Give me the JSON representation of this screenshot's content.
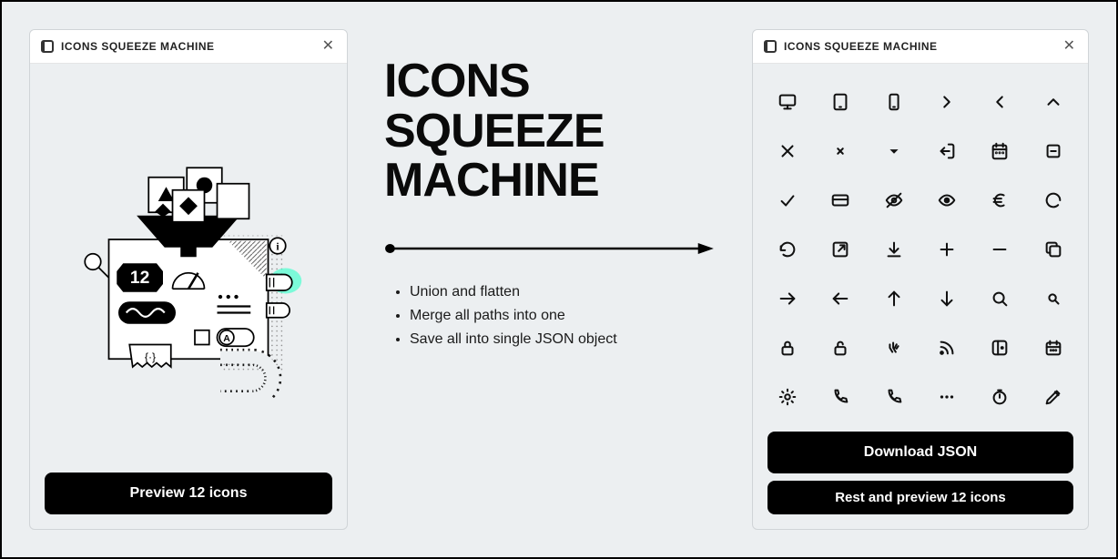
{
  "left_panel": {
    "title": "ICONS SQUEEZE MACHINE",
    "illustration_number": "12",
    "preview_button": "Preview 12 icons"
  },
  "center": {
    "headline_line1": "ICONS",
    "headline_line2": "SQUEEZE",
    "headline_line3": "MACHINE",
    "bullets": [
      "Union and flatten",
      "Merge all paths into one",
      "Save all into single JSON object"
    ]
  },
  "right_panel": {
    "title": "ICONS SQUEEZE MACHINE",
    "download_button": "Download JSON",
    "reset_button": "Rest and preview 12 icons",
    "icons": [
      "monitor",
      "tablet",
      "mobile",
      "chevron-right",
      "chevron-left",
      "chevron-up",
      "x-large",
      "x-small",
      "caret-down",
      "logout",
      "calendar",
      "note",
      "check",
      "card",
      "eye-off",
      "eye",
      "euro",
      "refresh-partial",
      "undo",
      "external",
      "download",
      "plus",
      "minus",
      "copy",
      "arrow-right",
      "arrow-left",
      "arrow-up",
      "arrow-down",
      "search",
      "search-small",
      "lock",
      "unlock",
      "peace",
      "rss",
      "sidebar",
      "date-picker",
      "gear",
      "phone",
      "phone-alt",
      "more",
      "timer",
      "edit"
    ]
  }
}
